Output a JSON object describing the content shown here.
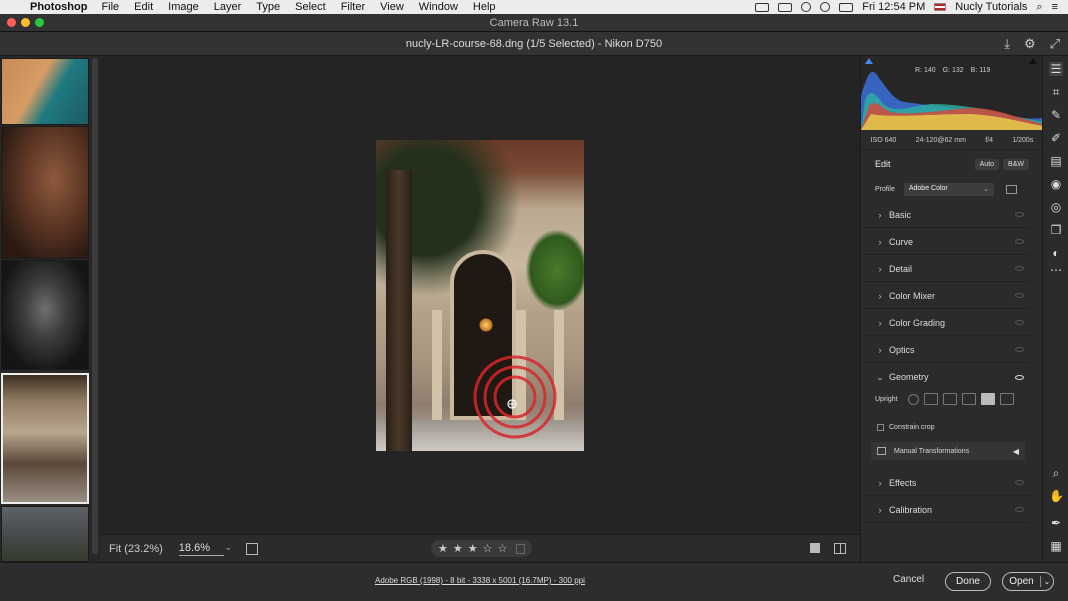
{
  "menubar": {
    "app_name": "Photoshop",
    "menus": [
      "File",
      "Edit",
      "Image",
      "Layer",
      "Type",
      "Select",
      "Filter",
      "View",
      "Window",
      "Help"
    ],
    "clock": "Fri 12:54 PM",
    "user": "Nucly Tutorials"
  },
  "window": {
    "title": "Camera Raw 13.1",
    "document": "nucly-LR-course-68.dng (1/5 Selected)  -  Nikon D750"
  },
  "histogram": {
    "r_label": "R:",
    "r": "140",
    "g_label": "G:",
    "g": "132",
    "b_label": "B:",
    "b": "119"
  },
  "exif": {
    "iso": "ISO 640",
    "lens": "24-120@62 mm",
    "aperture": "f/4",
    "shutter": "1/200s"
  },
  "edit": {
    "title": "Edit",
    "auto": "Auto",
    "bw": "B&W",
    "profile_label": "Profile",
    "profile_value": "Adobe Color"
  },
  "sections": [
    {
      "label": "Basic",
      "open": false
    },
    {
      "label": "Curve",
      "open": false
    },
    {
      "label": "Detail",
      "open": false
    },
    {
      "label": "Color Mixer",
      "open": false
    },
    {
      "label": "Color Grading",
      "open": false
    },
    {
      "label": "Optics",
      "open": false
    },
    {
      "label": "Geometry",
      "open": true
    },
    {
      "label": "Effects",
      "open": false
    },
    {
      "label": "Calibration",
      "open": false
    }
  ],
  "geometry": {
    "upright_label": "Upright",
    "constrain_label": "Constrain crop",
    "manual_label": "Manual Transformations"
  },
  "canvas_bar": {
    "fit": "Fit (23.2%)",
    "zoom": "18.6%",
    "rating": 3,
    "max_rating": 5
  },
  "footer": {
    "workflow": "Adobe RGB (1998) - 8 bit - 3338 x 5001 (16.7MP) - 300 ppi",
    "cancel": "Cancel",
    "done": "Done",
    "open": "Open"
  },
  "colors": {
    "accent": "#ffffff",
    "target": "#d8262b"
  }
}
